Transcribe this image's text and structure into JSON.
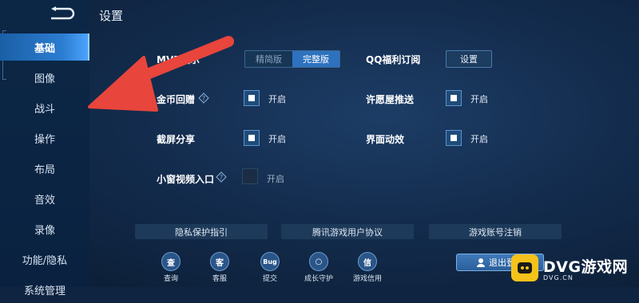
{
  "page": {
    "title": "设置"
  },
  "sidebar": {
    "items": [
      {
        "label": "基础",
        "active": true
      },
      {
        "label": "图像"
      },
      {
        "label": "战斗"
      },
      {
        "label": "操作"
      },
      {
        "label": "布局"
      },
      {
        "label": "音效"
      },
      {
        "label": "录像"
      },
      {
        "label": "功能/隐私"
      },
      {
        "label": "系统管理"
      }
    ]
  },
  "settings": {
    "mvp": {
      "label": "MVP展示",
      "options": [
        "精简版",
        "完整版"
      ],
      "selected": "完整版"
    },
    "qq_sub": {
      "label": "QQ福利订阅",
      "button": "设置"
    },
    "gold_replay": {
      "label": "金币回赠",
      "toggle_text": "开启",
      "checked": true
    },
    "wish_push": {
      "label": "许愿屋推送",
      "toggle_text": "开启",
      "checked": true
    },
    "screenshot_share": {
      "label": "截屏分享",
      "toggle_text": "开启",
      "checked": true
    },
    "ui_anim": {
      "label": "界面动效",
      "toggle_text": "开启",
      "checked": true
    },
    "mini_video": {
      "label": "小窗视频入口",
      "toggle_text": "开启",
      "checked": false
    }
  },
  "links": [
    "隐私保护指引",
    "腾讯游戏用户协议",
    "游戏账号注销"
  ],
  "bottom_bar": {
    "items": [
      {
        "label": "查询",
        "icon": "search-doc-icon",
        "glyph": "查"
      },
      {
        "label": "客服",
        "icon": "support-cat-icon",
        "glyph": "客"
      },
      {
        "label": "提交",
        "icon": "bug-icon",
        "glyph": "Bug"
      },
      {
        "label": "成长守护",
        "icon": "ring-icon",
        "glyph": "○"
      },
      {
        "label": "游戏信用",
        "icon": "shield-icon",
        "glyph": "信"
      }
    ],
    "logout": "退出登录"
  },
  "watermark": {
    "brand": "DVG游戏网",
    "site": "DVG.CN"
  },
  "colors": {
    "accent": "#2b7dd1",
    "annotation_arrow": "#e8453c",
    "watermark_badge": "#f5c21a"
  }
}
